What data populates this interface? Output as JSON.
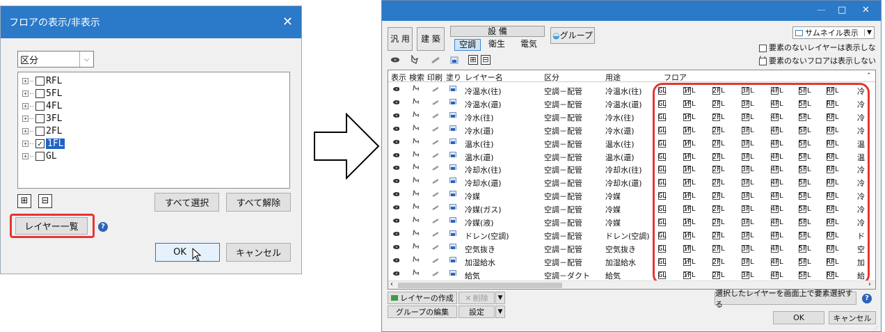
{
  "dialog1": {
    "title": "フロアの表示/非表示",
    "close": "✕",
    "combo_value": "区分",
    "tree": [
      {
        "label": "RFL",
        "checked": false,
        "selected": false
      },
      {
        "label": "5FL",
        "checked": false,
        "selected": false
      },
      {
        "label": "4FL",
        "checked": false,
        "selected": false
      },
      {
        "label": "3FL",
        "checked": false,
        "selected": false
      },
      {
        "label": "2FL",
        "checked": false,
        "selected": false
      },
      {
        "label": "1FL",
        "checked": true,
        "selected": true
      },
      {
        "label": "GL",
        "checked": false,
        "selected": false
      }
    ],
    "expand_all": "⊞",
    "collapse_all": "⊟",
    "select_all": "すべて選択",
    "deselect_all": "すべて解除",
    "layer_list": "レイヤー一覧",
    "ok": "OK",
    "cancel": "キャンセル"
  },
  "window": {
    "minimize": "—",
    "maximize": "□",
    "close": "✕",
    "tabs": {
      "general": "汎 用",
      "building": "建 築",
      "equipment": "設 備",
      "hvac": "空調",
      "sanitary": "衛生",
      "electric": "電気",
      "group": "グループ"
    },
    "thumbnail": "サムネイル表示",
    "hide_empty_layer": "要素のないレイヤーは表示しない",
    "hide_empty_floor": "要素のないフロアは表示しない",
    "headers": {
      "display": "表示",
      "search": "検索",
      "print": "印刷",
      "fill": "塗り",
      "layer_name": "レイヤー名",
      "category": "区分",
      "usage": "用途",
      "floor": "フロア"
    },
    "floor_labels": [
      "GL",
      "1FL",
      "2FL",
      "3FL",
      "4FL",
      "5FL",
      "RFL"
    ],
    "rows": [
      {
        "name": "冷温水(往)",
        "category": "空調－配管",
        "usage": "冷温水(往)",
        "tail": "冷"
      },
      {
        "name": "冷温水(還)",
        "category": "空調－配管",
        "usage": "冷温水(還)",
        "tail": "冷"
      },
      {
        "name": "冷水(往)",
        "category": "空調－配管",
        "usage": "冷水(往)",
        "tail": "冷"
      },
      {
        "name": "冷水(還)",
        "category": "空調－配管",
        "usage": "冷水(還)",
        "tail": "冷"
      },
      {
        "name": "温水(往)",
        "category": "空調－配管",
        "usage": "温水(往)",
        "tail": "温"
      },
      {
        "name": "温水(還)",
        "category": "空調－配管",
        "usage": "温水(還)",
        "tail": "温"
      },
      {
        "name": "冷却水(往)",
        "category": "空調－配管",
        "usage": "冷却水(往)",
        "tail": "冷"
      },
      {
        "name": "冷却水(還)",
        "category": "空調－配管",
        "usage": "冷却水(還)",
        "tail": "冷"
      },
      {
        "name": "冷媒",
        "category": "空調－配管",
        "usage": "冷媒",
        "tail": "冷"
      },
      {
        "name": "冷媒(ガス)",
        "category": "空調－配管",
        "usage": "冷媒",
        "tail": "冷"
      },
      {
        "name": "冷媒(液)",
        "category": "空調－配管",
        "usage": "冷媒",
        "tail": "冷"
      },
      {
        "name": "ドレン(空調)",
        "category": "空調－配管",
        "usage": "ドレン(空調)",
        "tail": "ド"
      },
      {
        "name": "空気抜き",
        "category": "空調－配管",
        "usage": "空気抜き",
        "tail": "空"
      },
      {
        "name": "加湿給水",
        "category": "空調－配管",
        "usage": "加湿給水",
        "tail": "加"
      },
      {
        "name": "給気",
        "category": "空調－ダクト",
        "usage": "給気",
        "tail": "給"
      }
    ],
    "create_layer": "レイヤーの作成",
    "delete": "削除",
    "edit_group": "グループの編集",
    "settings": "設定",
    "select_on_screen": "選択したレイヤーを画面上で要素選択する",
    "ok": "OK",
    "cancel": "キャンセル"
  },
  "colors": {
    "titlebar": "#2b79c9",
    "highlight": "#e53535",
    "selection": "#1f62c8"
  }
}
